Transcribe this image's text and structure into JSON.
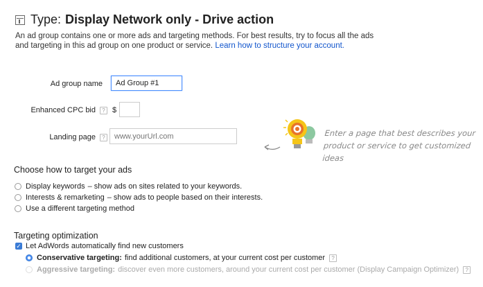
{
  "header": {
    "prefix": "Type:",
    "title": "Display Network only - Drive action",
    "description": "An ad group contains one or more ads and targeting methods. For best results, try to focus all the ads and targeting in this ad group on one product or service.",
    "link": "Learn how to structure your account."
  },
  "form": {
    "ad_group_name_label": "Ad group name",
    "ad_group_name_value": "Ad Group #1",
    "cpc_label": "Enhanced CPC bid",
    "currency": "$",
    "cpc_value": "",
    "landing_label": "Landing page",
    "landing_placeholder": "www.yourUrl.com",
    "help_glyph": "?"
  },
  "hint": {
    "text": "Enter a page that best describes your product or service to get customized ideas",
    "icon": "lightbulb-icon"
  },
  "targeting": {
    "title": "Choose how to target your ads",
    "options": [
      {
        "label": "Display keywords",
        "detail": "– show ads on sites related to your keywords."
      },
      {
        "label": "Interests & remarketing",
        "detail": "– show ads to people based on their interests."
      },
      {
        "label": "Use a different targeting method",
        "detail": ""
      }
    ]
  },
  "optimization": {
    "title": "Targeting optimization",
    "checkbox_label": "Let AdWords automatically find new customers",
    "checked": true,
    "options": [
      {
        "label": "Conservative targeting:",
        "detail": "find additional customers, at your current cost per customer",
        "selected": true
      },
      {
        "label": "Aggressive targeting:",
        "detail": "discover even more customers, around your current cost per customer (Display Campaign Optimizer)",
        "selected": false
      }
    ]
  },
  "colors": {
    "accent": "#3a7bd5",
    "link": "#1155cc",
    "bulb_yellow": "#f5c518",
    "bulb_orange": "#e8732a",
    "bulb_green": "#8cc8a0"
  }
}
